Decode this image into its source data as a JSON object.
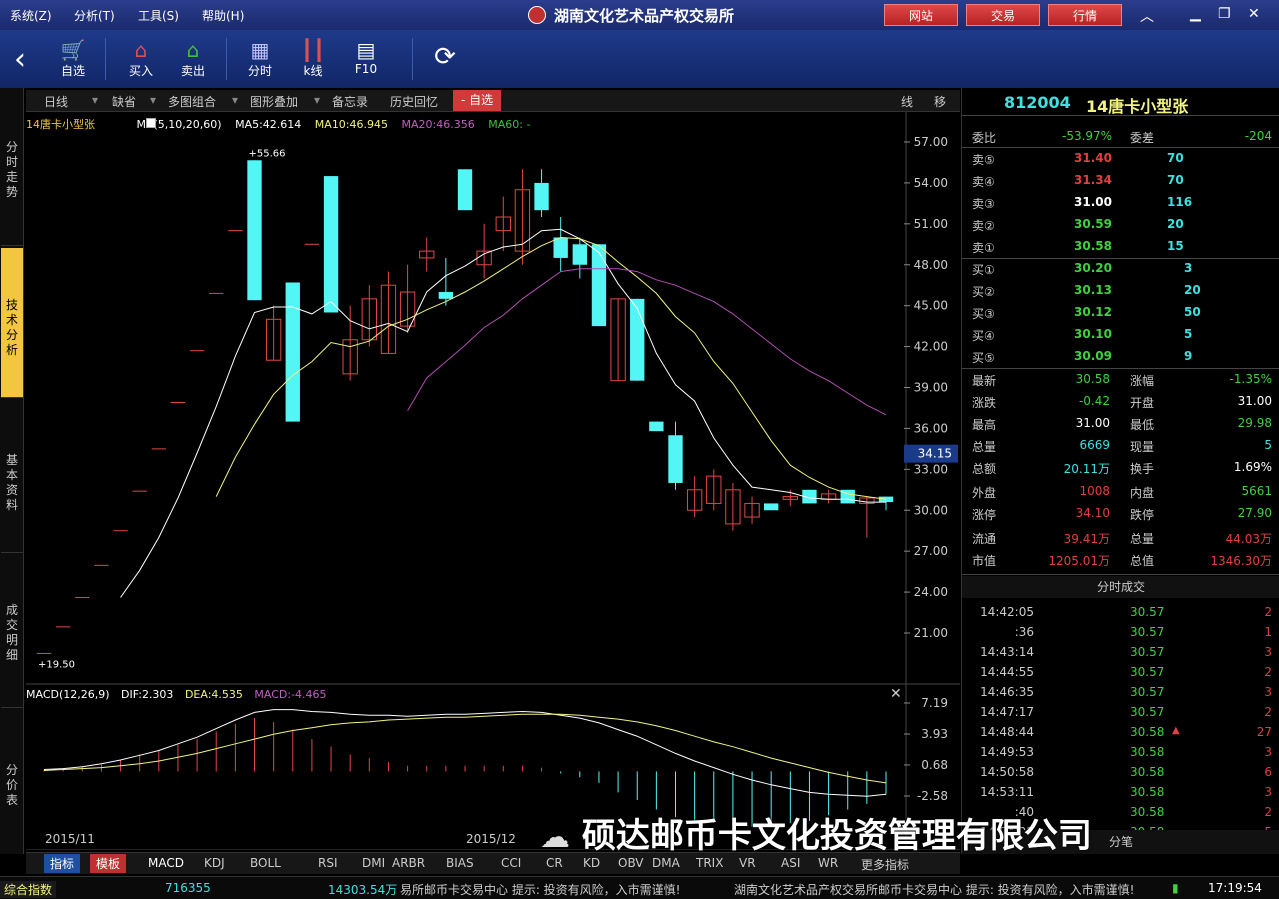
{
  "menu": {
    "items": [
      "系统(Z)",
      "分析(T)",
      "工具(S)",
      "帮助(H)"
    ],
    "title": "湖南文化艺术品产权交易所",
    "buttons": [
      "网站",
      "交易",
      "行情"
    ]
  },
  "toolbar": {
    "items": [
      "自选",
      "买入",
      "卖出",
      "分时",
      "k线",
      "F10"
    ]
  },
  "left_tabs": [
    "分时走势",
    "技术分析",
    "基本资料",
    "成交明细",
    "分价表"
  ],
  "chart_tabs": [
    "日线",
    "缺省",
    "多图组合",
    "图形叠加",
    "备忘录",
    "历史回忆",
    "- 自选",
    "线",
    "移"
  ],
  "main": {
    "name": "14唐卡小型张",
    "ma": "MA(5,10,20,60)",
    "ma5": "MA5:42.614",
    "ma10": "MA10:46.945",
    "ma20": "MA20:46.356",
    "ma60": "MA60: -",
    "high_label": "55.66",
    "low_label": "19.50",
    "price_marker": "34.15",
    "months": [
      "2015/11",
      "2015/12"
    ]
  },
  "macd": {
    "title": "MACD(12,26,9)",
    "dif": "DIF:2.303",
    "dea": "DEA:4.535",
    "macd": "MACD:-4.465"
  },
  "chart_data": {
    "type": "candlestick",
    "y_ticks": [
      "57.00",
      "54.00",
      "51.00",
      "48.00",
      "45.00",
      "42.00",
      "39.00",
      "36.00",
      "33.00",
      "30.00",
      "27.00",
      "24.00",
      "21.00"
    ],
    "ylim": [
      19.5,
      57.0
    ],
    "candles": [
      [
        19.5,
        19.5,
        19.5,
        19.5
      ],
      [
        21.45,
        21.45,
        21.45,
        21.45
      ],
      [
        23.6,
        23.6,
        23.6,
        23.6
      ],
      [
        25.96,
        25.96,
        25.96,
        25.96
      ],
      [
        28.5,
        28.5,
        28.5,
        28.5
      ],
      [
        31.4,
        31.4,
        31.4,
        31.4
      ],
      [
        34.5,
        34.5,
        34.5,
        34.5
      ],
      [
        37.9,
        37.9,
        37.9,
        37.9
      ],
      [
        41.7,
        41.7,
        41.7,
        41.7
      ],
      [
        45.9,
        45.9,
        45.9,
        45.9
      ],
      [
        50.5,
        50.5,
        50.5,
        50.5
      ],
      [
        55.66,
        45.4,
        55.66,
        45.4
      ],
      [
        41.0,
        44.0,
        45.0,
        41.0
      ],
      [
        46.7,
        36.5,
        46.7,
        36.5
      ],
      [
        49.5,
        49.5,
        49.5,
        49.5
      ],
      [
        54.5,
        44.5,
        54.5,
        44.5
      ],
      [
        40.0,
        42.5,
        45.0,
        39.5
      ],
      [
        42.5,
        45.5,
        46.5,
        42.0
      ],
      [
        41.5,
        46.5,
        47.5,
        41.5
      ],
      [
        43.5,
        46.0,
        48.0,
        43.0
      ],
      [
        48.5,
        49.0,
        50.0,
        47.5
      ],
      [
        46.0,
        45.5,
        48.5,
        45.0
      ],
      [
        55.0,
        52.0,
        55.0,
        52.0
      ],
      [
        48.0,
        49.0,
        51.0,
        47.0
      ],
      [
        50.5,
        51.5,
        53.0,
        49.0
      ],
      [
        49.0,
        53.5,
        55.0,
        48.0
      ],
      [
        54.0,
        52.0,
        55.0,
        51.5
      ],
      [
        50.0,
        48.5,
        51.5,
        47.5
      ],
      [
        49.5,
        48.0,
        50.0,
        47.0
      ],
      [
        49.5,
        43.5,
        49.5,
        43.5
      ],
      [
        39.5,
        45.5,
        45.5,
        39.5
      ],
      [
        45.5,
        39.5,
        45.5,
        39.5
      ],
      [
        36.5,
        35.8,
        36.5,
        35.8
      ],
      [
        35.5,
        32.0,
        36.5,
        31.5
      ],
      [
        30.0,
        31.5,
        32.5,
        29.5
      ],
      [
        30.5,
        32.5,
        33.0,
        30.0
      ],
      [
        29.0,
        31.5,
        32.0,
        28.5
      ],
      [
        29.5,
        30.5,
        31.0,
        29.0
      ],
      [
        30.5,
        30.0,
        30.5,
        30.0
      ],
      [
        30.8,
        31.0,
        31.5,
        30.3
      ],
      [
        31.5,
        30.5,
        31.5,
        30.5
      ],
      [
        30.8,
        31.2,
        31.5,
        30.5
      ],
      [
        31.5,
        30.5,
        31.5,
        30.5
      ],
      [
        30.5,
        30.9,
        31.0,
        28.0
      ],
      [
        31.0,
        30.6,
        31.0,
        30.0
      ]
    ],
    "ma5": [
      null,
      null,
      null,
      null,
      23.6,
      25.6,
      28.0,
      30.9,
      34.2,
      37.6,
      41.3,
      44.5,
      44.9,
      44.9,
      44.4,
      45.3,
      43.9,
      43.3,
      43.7,
      43.1,
      46.0,
      47.2,
      47.9,
      48.8,
      49.3,
      49.5,
      50.5,
      50.6,
      49.9,
      48.9,
      46.6,
      44.8,
      41.5,
      39.2,
      38.0,
      35.3,
      33.3,
      31.7,
      31.5,
      31.3,
      30.9,
      30.8,
      30.8,
      30.6,
      30.6
    ],
    "ma10": [
      null,
      null,
      null,
      null,
      null,
      null,
      null,
      null,
      null,
      31.0,
      33.9,
      36.3,
      38.5,
      39.9,
      40.9,
      42.3,
      42.0,
      42.4,
      43.5,
      44.0,
      44.7,
      45.3,
      46.0,
      46.8,
      47.7,
      48.6,
      49.4,
      50.0,
      49.9,
      49.4,
      48.2,
      47.1,
      45.9,
      44.2,
      43.0,
      40.9,
      39.3,
      37.2,
      35.1,
      33.3,
      32.4,
      31.7,
      31.2,
      31.0,
      30.8
    ],
    "ma20": [
      null,
      null,
      null,
      null,
      null,
      null,
      null,
      null,
      null,
      null,
      null,
      null,
      null,
      null,
      null,
      null,
      null,
      null,
      null,
      37.3,
      39.7,
      40.9,
      42.1,
      43.4,
      44.3,
      45.5,
      46.5,
      47.5,
      47.7,
      47.7,
      47.7,
      47.5,
      46.9,
      46.5,
      45.9,
      45.3,
      44.4,
      43.3,
      42.2,
      41.1,
      40.2,
      39.5,
      38.6,
      37.7,
      37.0
    ],
    "macd_ticks": [
      "7.19",
      "3.93",
      "0.68",
      "-2.58"
    ],
    "macd_ylim": [
      -3.5,
      8.2
    ],
    "dif": [
      0.2,
      0.3,
      0.5,
      0.8,
      1.2,
      1.7,
      2.2,
      2.9,
      3.6,
      4.5,
      5.4,
      6.2,
      6.5,
      6.5,
      6.3,
      6.2,
      6.0,
      5.9,
      5.9,
      5.8,
      5.9,
      6.0,
      6.0,
      6.1,
      6.2,
      6.3,
      6.2,
      5.9,
      5.6,
      5.1,
      4.4,
      3.7,
      2.8,
      1.9,
      1.1,
      0.4,
      -0.3,
      -0.9,
      -1.4,
      -1.8,
      -2.2,
      -2.4,
      -2.5,
      -2.6,
      -2.4
    ],
    "dea": [
      0.1,
      0.2,
      0.3,
      0.4,
      0.6,
      0.8,
      1.1,
      1.5,
      1.9,
      2.4,
      2.9,
      3.4,
      3.9,
      4.3,
      4.6,
      4.9,
      5.1,
      5.2,
      5.4,
      5.5,
      5.6,
      5.7,
      5.7,
      5.8,
      5.9,
      6.0,
      6.0,
      6.0,
      5.9,
      5.7,
      5.5,
      5.2,
      4.8,
      4.3,
      3.7,
      3.1,
      2.6,
      2.0,
      1.4,
      0.9,
      0.4,
      -0.1,
      -0.5,
      -0.9,
      -1.2
    ],
    "macd_hist": [
      0.2,
      0.3,
      0.5,
      0.8,
      1.2,
      1.8,
      2.2,
      2.8,
      3.4,
      4.2,
      5.0,
      5.6,
      5.2,
      4.4,
      3.4,
      2.6,
      1.8,
      1.4,
      1.0,
      0.6,
      0.6,
      0.6,
      0.6,
      0.6,
      0.6,
      0.6,
      0.4,
      -0.2,
      -0.6,
      -1.2,
      -2.2,
      -3.0,
      -4.0,
      -4.8,
      -5.2,
      -5.4,
      -5.8,
      -5.8,
      -5.6,
      -5.4,
      -5.2,
      -4.6,
      -4.0,
      -3.4,
      -2.4
    ]
  },
  "quote": {
    "code": "812004",
    "name": "14唐卡小型张",
    "weibi_label": "委比",
    "weibi": "-53.97%",
    "weicha_label": "委差",
    "weicha": "-204",
    "sells": [
      {
        "l": "卖⑤",
        "p": "31.40",
        "v": "70"
      },
      {
        "l": "卖④",
        "p": "31.34",
        "v": "70"
      },
      {
        "l": "卖③",
        "p": "31.00",
        "v": "116"
      },
      {
        "l": "卖②",
        "p": "30.59",
        "v": "20"
      },
      {
        "l": "卖①",
        "p": "30.58",
        "v": "15"
      }
    ],
    "buys": [
      {
        "l": "买①",
        "p": "30.20",
        "v": "3"
      },
      {
        "l": "买②",
        "p": "30.13",
        "v": "20"
      },
      {
        "l": "买③",
        "p": "30.12",
        "v": "50"
      },
      {
        "l": "买④",
        "p": "30.10",
        "v": "5"
      },
      {
        "l": "买⑤",
        "p": "30.09",
        "v": "9"
      }
    ],
    "stats": [
      [
        "最新",
        "30.58",
        "涨幅",
        "-1.35%"
      ],
      [
        "涨跌",
        "-0.42",
        "开盘",
        "31.00"
      ],
      [
        "最高",
        "31.00",
        "最低",
        "29.98"
      ],
      [
        "总量",
        "6669",
        "现量",
        "5"
      ],
      [
        "总额",
        "20.11万",
        "换手",
        "1.69%"
      ],
      [
        "外盘",
        "1008",
        "内盘",
        "5661"
      ],
      [
        "涨停",
        "34.10",
        "跌停",
        "27.90"
      ],
      [
        "流通",
        "39.41万",
        "总量",
        "44.03万"
      ],
      [
        "市值",
        "1205.01万",
        "总值",
        "1346.30万"
      ]
    ],
    "ticks_title": "分时成交",
    "ticks": [
      [
        "14:42:05",
        "30.57",
        "2"
      ],
      [
        ":36",
        "30.57",
        "1"
      ],
      [
        "14:43:14",
        "30.57",
        "3"
      ],
      [
        "14:44:55",
        "30.57",
        "2"
      ],
      [
        "14:46:35",
        "30.57",
        "3"
      ],
      [
        "14:47:17",
        "30.57",
        "2"
      ],
      [
        "14:48:44",
        "30.58",
        "27"
      ],
      [
        "14:49:53",
        "30.58",
        "3"
      ],
      [
        "14:50:58",
        "30.58",
        "6"
      ],
      [
        "14:53:11",
        "30.58",
        "3"
      ],
      [
        ":40",
        "30.58",
        "2"
      ],
      [
        "14:54:22",
        "30.58",
        "5"
      ]
    ],
    "fenbi": "分笔"
  },
  "bottom_tabs": [
    "指标",
    "模板",
    "MACD",
    "KDJ",
    "BOLL",
    "RSI",
    "DMI",
    "ARBR",
    "BIAS",
    "CCI",
    "CR",
    "KD",
    "OBV",
    "DMA",
    "TRIX",
    "VR",
    "ASI",
    "WR",
    "更多指标"
  ],
  "status": {
    "index": "综合指数",
    "v1": "716355",
    "v2": "14303.54万",
    "text1": "易所邮币卡交易中心  提示:  投资有风险，入市需谨慎!",
    "text2": "湖南文化艺术品产权交易所邮币卡交易中心  提示:  投资有风险，入市需谨慎!",
    "time": "17:19:54"
  },
  "watermark": "硕达邮币卡文化投资管理有限公司"
}
